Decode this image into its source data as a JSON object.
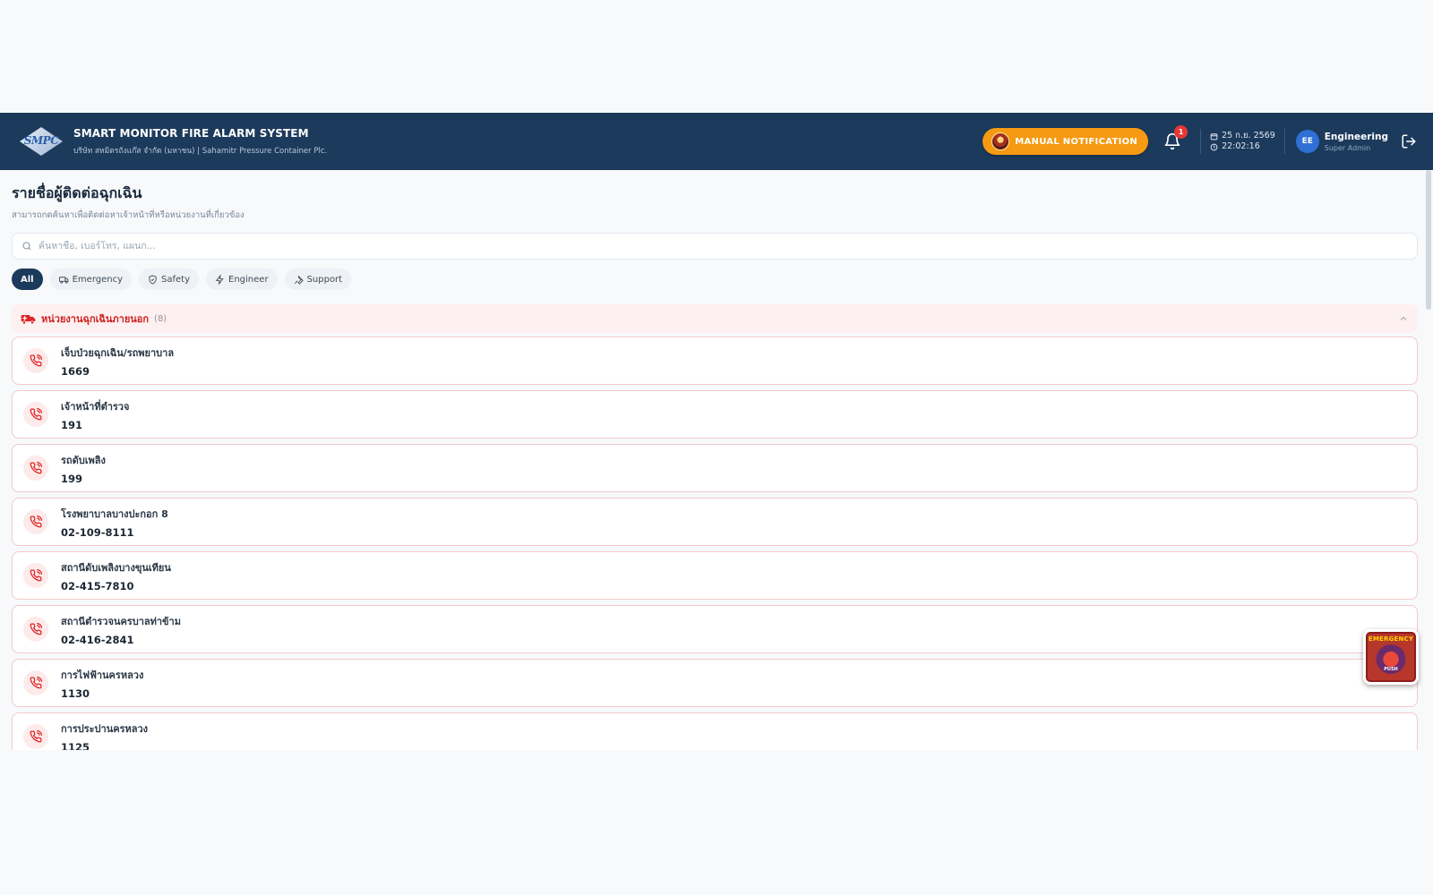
{
  "header": {
    "logo_text": "SMPC",
    "title": "SMART MONITOR FIRE ALARM SYSTEM",
    "subtitle": "บริษัท สหมิตรถังแก๊ส จำกัด (มหาชน) | Sahamitr Pressure Container Plc.",
    "manual_button_label": "MANUAL NOTIFICATION",
    "notification_count": "1",
    "date": "25 ก.ย. 2569",
    "time": "22:02:16",
    "user_initials": "EE",
    "user_name": "Engineering",
    "user_role": "Super Admin"
  },
  "page": {
    "title": "รายชื่อผู้ติดต่อฉุกเฉิน",
    "subtitle": "สามารถกดค้นหาเพื่อติดต่อหาเจ้าหน้าที่หรือหน่วยงานที่เกี่ยวข้อง"
  },
  "search": {
    "placeholder": "ค้นหาชื่อ, เบอร์โทร, แผนก...",
    "value": ""
  },
  "filters": [
    {
      "label": "All",
      "icon": "none",
      "active": true
    },
    {
      "label": "Emergency",
      "icon": "ambulance-icon",
      "active": false
    },
    {
      "label": "Safety",
      "icon": "shield-icon",
      "active": false
    },
    {
      "label": "Engineer",
      "icon": "lightning-icon",
      "active": false
    },
    {
      "label": "Support",
      "icon": "wrench-icon",
      "active": false
    }
  ],
  "group": {
    "title": "หน่วยงานฉุกเฉินภายนอก",
    "count": "(8)",
    "accent": "#cf1f1f",
    "contacts": [
      {
        "name": "เจ็บป่วยฉุกเฉิน/รถพยาบาล",
        "number": "1669"
      },
      {
        "name": "เจ้าหน้าที่ตำรวจ",
        "number": "191"
      },
      {
        "name": "รถดับเพลิง",
        "number": "199"
      },
      {
        "name": "โรงพยาบาลบางปะกอก 8",
        "number": "02-109-8111"
      },
      {
        "name": "สถานีดับเพลิงบางขุนเทียน",
        "number": "02-415-7810"
      },
      {
        "name": "สถานีตำรวจนครบาลท่าข้าม",
        "number": "02-416-2841"
      },
      {
        "name": "การไฟฟ้านครหลวง",
        "number": "1130"
      },
      {
        "name": "การประปานครหลวง",
        "number": "1125"
      }
    ]
  },
  "sos": {
    "label": "EMERGENCY",
    "push": "PUSH"
  },
  "colors": {
    "header_bg": "#1c3a5c",
    "manual_button": "#f59a12",
    "badge": "#e53935"
  }
}
